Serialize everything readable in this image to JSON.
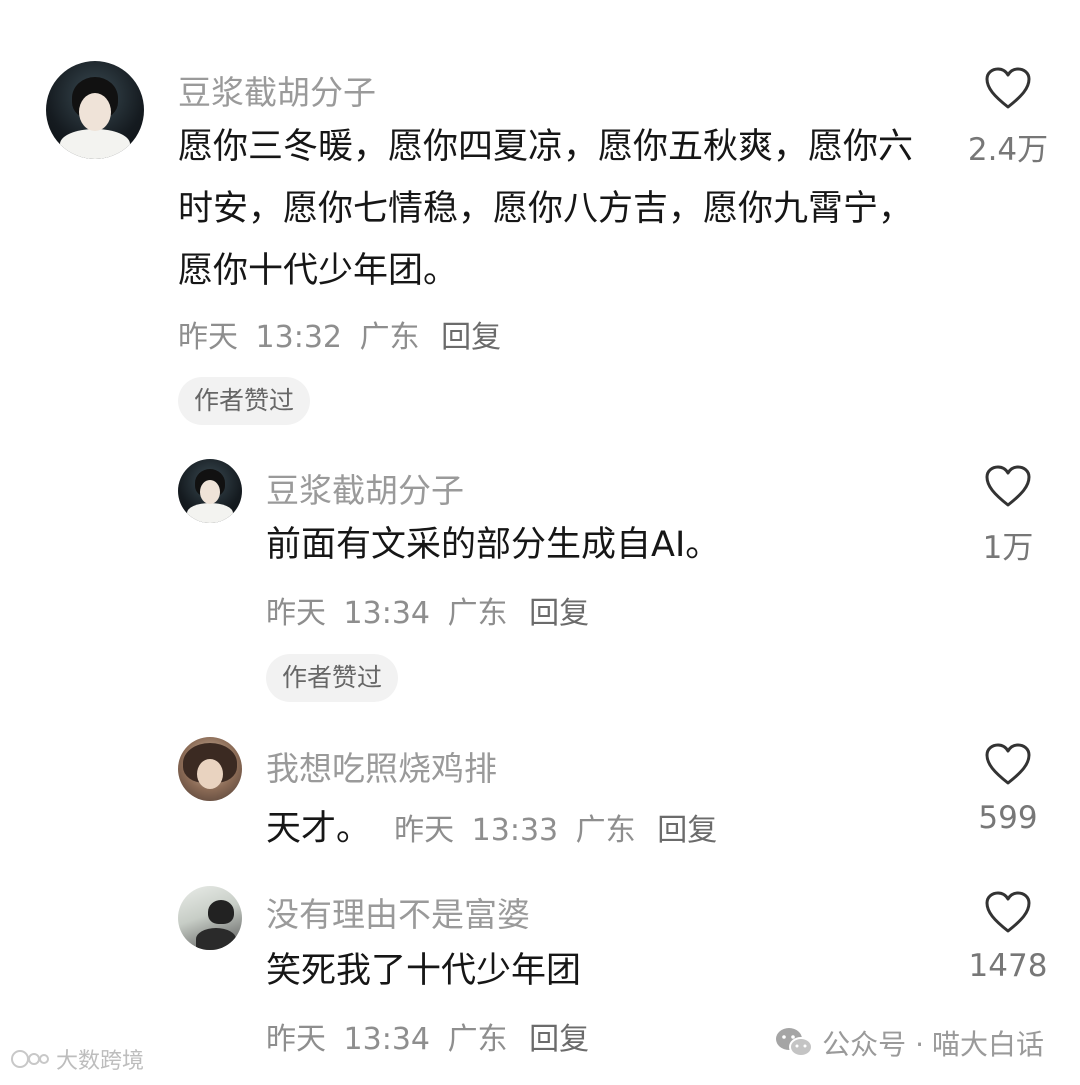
{
  "comments": [
    {
      "username": "豆浆截胡分子",
      "content": "愿你三冬暖，愿你四夏凉，愿你五秋爽，愿你六时安，愿你七情稳，愿你八方吉，愿你九霄宁，愿你十代少年团。",
      "date": "昨天",
      "time": "13:32",
      "location": "广东",
      "reply": "回复",
      "badge": "作者赞过",
      "likes": "2.4万"
    },
    {
      "username": "豆浆截胡分子",
      "content": "前面有文采的部分生成自AI。",
      "date": "昨天",
      "time": "13:34",
      "location": "广东",
      "reply": "回复",
      "badge": "作者赞过",
      "likes": "1万"
    },
    {
      "username": "我想吃照烧鸡排",
      "content": "天才。",
      "date": "昨天",
      "time": "13:33",
      "location": "广东",
      "reply": "回复",
      "likes": "599"
    },
    {
      "username": "没有理由不是富婆",
      "content": "笑死我了十代少年团",
      "date": "昨天",
      "time": "13:34",
      "location": "广东",
      "reply": "回复",
      "likes": "1478"
    }
  ],
  "icons": {
    "like": "heart-outline-icon",
    "wechat": "wechat-icon"
  },
  "watermarks": {
    "left": "大数跨境",
    "right_prefix": "公众号 · ",
    "right_name": "喵大白话"
  },
  "colors": {
    "username": "#9a9a9a",
    "text": "#161616",
    "meta": "#8e8e8e",
    "badge_bg": "#f2f2f2"
  }
}
